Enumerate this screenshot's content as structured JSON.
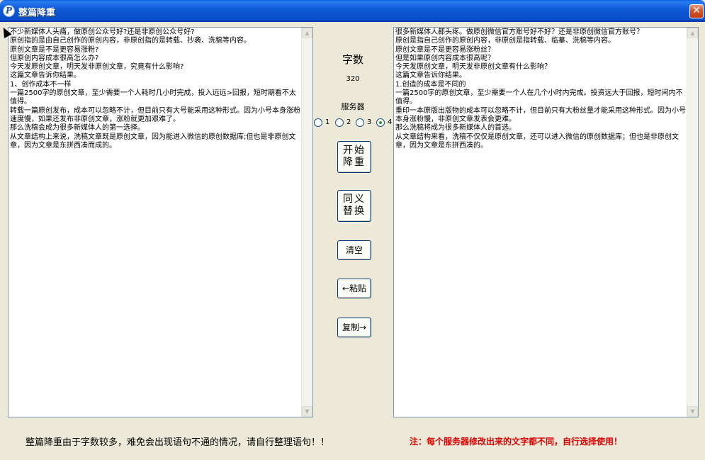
{
  "window": {
    "title": "整篇降重",
    "app_icon": "P",
    "close_glyph": "✕"
  },
  "left_textbox": {
    "text": "不少新媒体人头痛，做原创公众号好?还是非原创公众号好?\n原创指的是由自己创作的原创内容，非原创指的是转载、抄袭、洗稿等内容。\n原创文章是不是更容易涨粉?\n但原创内容成本很高怎么办?\n今天发原创文章，明天发非原创文章，究竟有什么影响?\n这篇文章告诉你结果。\n1、创作成本不一样\n一篇2500字的原创文章，至少需要一个人耗时几小时完成，投入远远>回报，短时期看不太值得。\n转载一篇原创发布，成本可以忽略不计，但目前只有大号能采用这种形式。因为小号本身涨粉速度慢，如果还发布非原创文章，涨粉就更加艰难了。\n那么洗稿会成为很多新媒体人的第一选择。\n从文章结构上来说，洗稿文章既是原创文章，因为能进入微信的原创数据库;但也是非原创文章，因为文章是东拼西凑而成的。"
  },
  "right_textbox": {
    "text": "很多新媒体人都头疼。做原创微信官方账号好不好？还是非原创微信官方账号？\n原创是指自己创作的原创内容，非原创是指转载、临摹、洗稿等内容。\n原创文章是不是更容易涨粉丝？\n但是如果原创内容成本很高呢？\n今天发原创文章，明天发非原创文章有什么影响？\n这篇文章告诉你结果。\n1.创造的成本是不同的\n一篇2500字的原创文章，至少需要一个人在几个小时内完成。投资远大于回报，短时间内不值得。\n重印一本原版出版物的成本可以忽略不计，但目前只有大粉丝量才能采用这种形式。因为小号本身涨粉慢，非原创文章发表会更难。\n那么洗稿将成为很多新媒体人的首选。\n从文章结构来看，洗稿不仅仅是原创文章，还可以进入微信的原创数据库；但也是非原创文章，因为文章是东拼西凑的。"
  },
  "center": {
    "word_count_label": "字数",
    "word_count_value": "320",
    "server_label": "服务器",
    "servers": [
      "1",
      "2",
      "3",
      "4"
    ],
    "selected_server": "4",
    "buttons": {
      "start": "开始\n降重",
      "synonym": "同义\n替换",
      "clear": "清空",
      "paste": "←粘贴",
      "copy": "复制→"
    }
  },
  "footer": {
    "note_left": "整篇降重由于字数较多，难免会出现语句不通的情况，请自行整理语句！！",
    "note_right": "注：每个服务器修改出来的文字都不同，自行选择使用！"
  },
  "colors": {
    "dialog_bg": "#ece9d8",
    "titlebar": "#0a4ec8",
    "warning_text": "#e00000",
    "radio_selected": "#21a121"
  }
}
